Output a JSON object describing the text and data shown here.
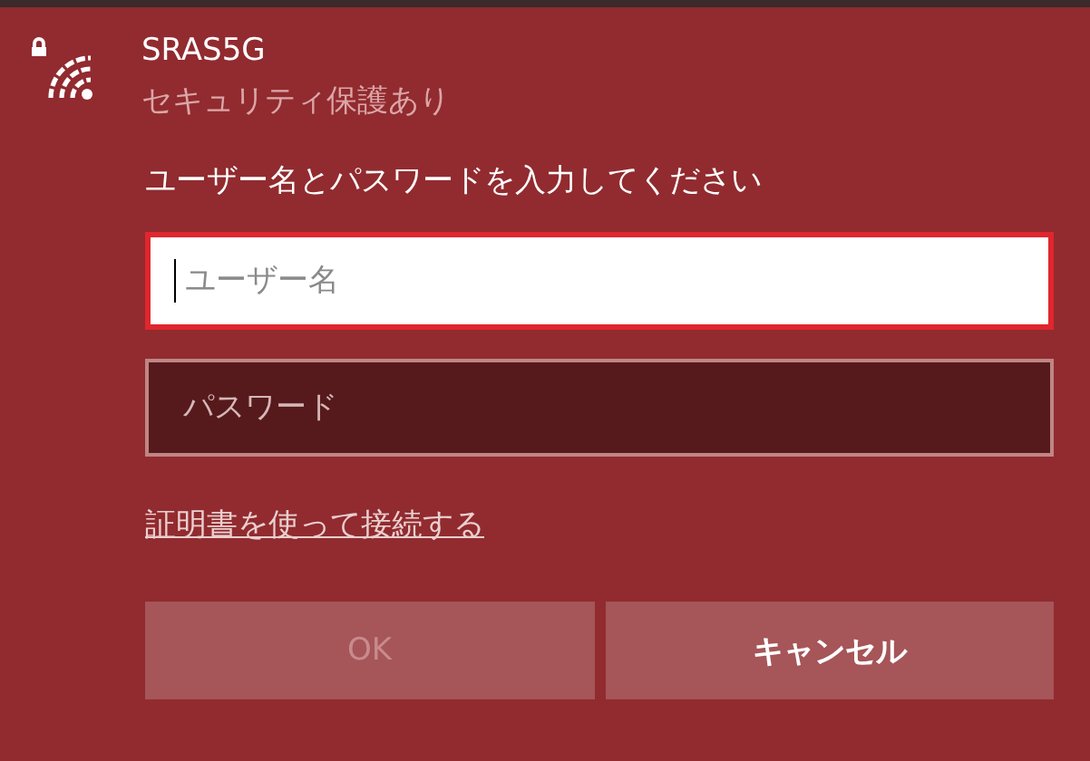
{
  "network": {
    "name": "SRAS5G",
    "security": "セキュリティ保護あり",
    "secured": true
  },
  "prompt": "ユーザー名とパスワードを入力してください",
  "fields": [
    {
      "kind": "text",
      "placeholder": "ユーザー名",
      "focused": true
    },
    {
      "kind": "password",
      "placeholder": "パスワード",
      "focused": false
    }
  ],
  "link": "証明書を使って接続する",
  "buttons": [
    {
      "label": "OK",
      "disabled": true
    },
    {
      "label": "キャンセル",
      "disabled": false
    }
  ]
}
